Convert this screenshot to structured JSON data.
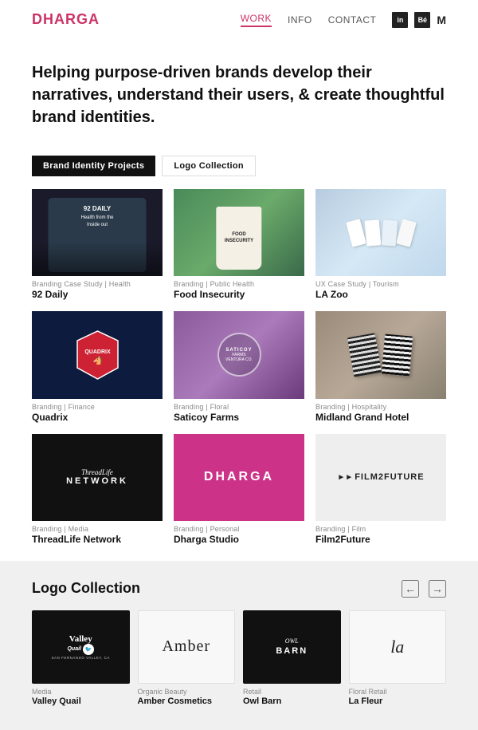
{
  "header": {
    "logo": "DHARGA",
    "nav": {
      "work_label": "WORK",
      "info_label": "INFO",
      "contact_label": "CONTACT"
    }
  },
  "hero": {
    "headline": "Helping purpose-driven brands develop their narratives, understand their users, & create thoughtful brand identities."
  },
  "filters": {
    "btn1_label": "Brand Identity Projects",
    "btn2_label": "Logo Collection"
  },
  "portfolio": {
    "items": [
      {
        "id": "92daily",
        "category": "Branding Case Study | Health",
        "title": "92 Daily"
      },
      {
        "id": "food-insecurity",
        "category": "Branding | Public Health",
        "title": "Food Insecurity"
      },
      {
        "id": "la-zoo",
        "category": "UX Case Study | Tourism",
        "title": "LA Zoo"
      },
      {
        "id": "quadrix",
        "category": "Branding | Finance",
        "title": "Quadrix"
      },
      {
        "id": "saticoy-farms",
        "category": "Branding | Floral",
        "title": "Saticoy Farms"
      },
      {
        "id": "midland-grand",
        "category": "Branding | Hospitality",
        "title": "Midland Grand Hotel"
      },
      {
        "id": "threadlife",
        "category": "Branding | Media",
        "title": "ThreadLife Network"
      },
      {
        "id": "dharga-studio",
        "category": "Branding | Personal",
        "title": "Dharga Studio"
      },
      {
        "id": "film2future",
        "category": "Branding | Film",
        "title": "Film2Future"
      }
    ]
  },
  "logo_collection": {
    "title": "Logo Collection",
    "arrow_left": "←",
    "arrow_right": "→",
    "items": [
      {
        "category": "Media",
        "title": "Valley Quail"
      },
      {
        "category": "Organic Beauty",
        "title": "Amber Cosmetics"
      },
      {
        "category": "Retail",
        "title": "Owl Barn"
      },
      {
        "category": "Floral Retail",
        "title": "La Fleur"
      }
    ]
  }
}
